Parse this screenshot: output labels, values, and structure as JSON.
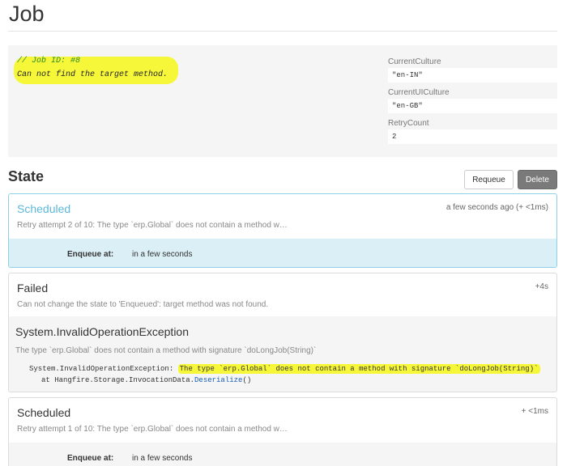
{
  "page": {
    "title": "Job"
  },
  "job": {
    "comment": "// Job ID: #8",
    "error": "Can not find the target method.",
    "properties": [
      {
        "label": "CurrentCulture",
        "value": "\"en-IN\""
      },
      {
        "label": "CurrentUICulture",
        "value": "\"en-GB\""
      },
      {
        "label": "RetryCount",
        "value": "2"
      }
    ]
  },
  "state": {
    "heading": "State",
    "requeue_label": "Requeue",
    "delete_label": "Delete",
    "history": [
      {
        "title": "Scheduled",
        "time": "a few seconds ago (+ <1ms)",
        "description": "Retry attempt 2 of 10: The type `erp.Global` does not contain a method w…",
        "enqueue_key": "Enqueue at:",
        "enqueue_value": "in a few seconds"
      },
      {
        "title": "Failed",
        "time": "+4s",
        "description": "Can not change the state to 'Enqueued': target method was not found.",
        "exception_type": "System.InvalidOperationException",
        "exception_message": "The type `erp.Global` does not contain a method with signature `doLongJob(String)`",
        "stack_prefix": "System.InvalidOperationException:",
        "stack_highlight": "The type `erp.Global` does not contain a method with signature `doLongJob(String)`",
        "stack_line2_prefix": "at Hangfire.Storage.InvocationData.",
        "stack_line2_method": "Deserialize",
        "stack_line2_suffix": "()"
      },
      {
        "title": "Scheduled",
        "time": "+ <1ms",
        "description": "Retry attempt 1 of 10: The type `erp.Global` does not contain a method w…",
        "enqueue_key": "Enqueue at:",
        "enqueue_value": "in a few seconds"
      }
    ]
  },
  "colors": {
    "highlight": "#f7f73a",
    "info": "#5bb8d9",
    "active_body": "#dbeff6"
  }
}
